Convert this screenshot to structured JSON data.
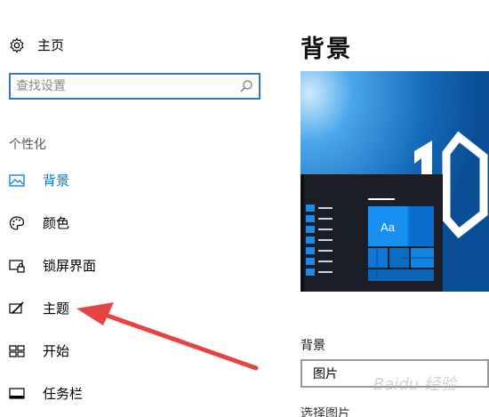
{
  "sidebar": {
    "home_label": "主页",
    "search_placeholder": "查找设置",
    "section_title": "个性化",
    "items": [
      {
        "label": "背景",
        "icon": "picture-icon",
        "active": true
      },
      {
        "label": "颜色",
        "icon": "palette-icon",
        "active": false
      },
      {
        "label": "锁屏界面",
        "icon": "lock-screen-icon",
        "active": false
      },
      {
        "label": "主题",
        "icon": "theme-brush-icon",
        "active": false
      },
      {
        "label": "开始",
        "icon": "start-tiles-icon",
        "active": false
      },
      {
        "label": "任务栏",
        "icon": "taskbar-icon",
        "active": false
      }
    ]
  },
  "main": {
    "title": "背景",
    "preview_tile_text": "Aa",
    "background_label": "背景",
    "background_value": "图片",
    "next_label_partial": "选择图片"
  },
  "colors": {
    "accent": "#0078d7",
    "arrow": "#e84343"
  },
  "watermark": "Baidu 经验"
}
